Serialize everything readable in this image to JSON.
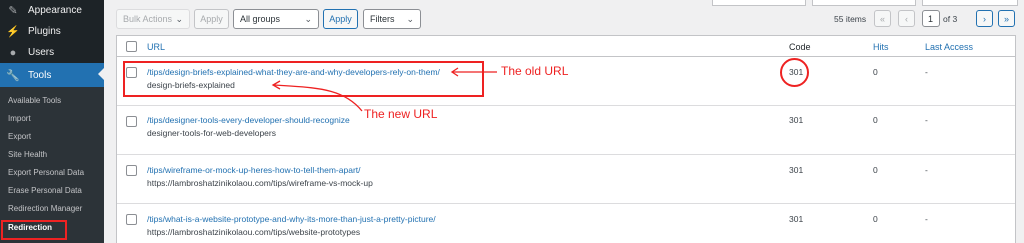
{
  "sidebar": {
    "menu": [
      {
        "label": "Appearance",
        "icon": "paintbrush-icon"
      },
      {
        "label": "Plugins",
        "icon": "plug-icon"
      },
      {
        "label": "Users",
        "icon": "user-icon"
      },
      {
        "label": "Tools",
        "icon": "wrench-icon",
        "active": true
      }
    ],
    "submenu": [
      "Available Tools",
      "Import",
      "Export",
      "Site Health",
      "Export Personal Data",
      "Erase Personal Data",
      "Redirection Manager",
      "Redirection"
    ]
  },
  "toolbar": {
    "bulk_actions": "Bulk Actions",
    "apply1": "Apply",
    "group_select": "All groups",
    "apply2": "Apply",
    "filters": "Filters"
  },
  "pagination": {
    "items": "55 items",
    "first": "«",
    "prev": "‹",
    "current_page": "1",
    "of_label": "of 3",
    "next": "›",
    "last": "»"
  },
  "table": {
    "headers": {
      "url": "URL",
      "code": "Code",
      "hits": "Hits",
      "last_access": "Last Access"
    },
    "rows": [
      {
        "url": "/tips/design-briefs-explained-what-they-are-and-why-developers-rely-on-them/",
        "target": "design-briefs-explained",
        "code": "301",
        "hits": "0",
        "last": "-"
      },
      {
        "url": "/tips/designer-tools-every-developer-should-recognize",
        "target": "designer-tools-for-web-developers",
        "code": "301",
        "hits": "0",
        "last": "-"
      },
      {
        "url": "/tips/wireframe-or-mock-up-heres-how-to-tell-them-apart/",
        "target": "https://lambroshatzinikolaou.com/tips/wireframe-vs-mock-up",
        "code": "301",
        "hits": "0",
        "last": "-"
      },
      {
        "url": "/tips/what-is-a-website-prototype-and-why-its-more-than-just-a-pretty-picture/",
        "target": "https://lambroshatzinikolaou.com/tips/website-prototypes",
        "code": "301",
        "hits": "0",
        "last": "-"
      }
    ]
  },
  "annotations": {
    "old_url": "The old URL",
    "new_url": "The new URL",
    "color": "#e22222"
  },
  "colors": {
    "accent": "#2271b1",
    "sidebar": "#1d2327",
    "submenu": "#2c3338"
  }
}
